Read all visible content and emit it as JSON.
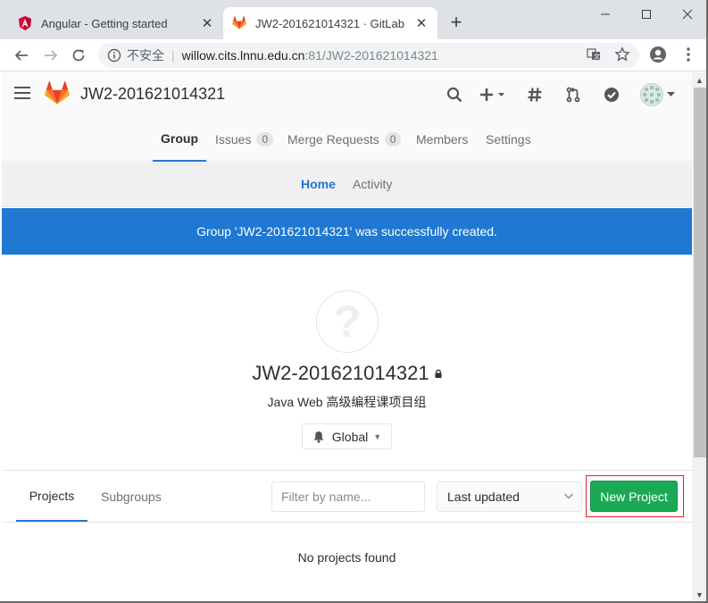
{
  "browser": {
    "tabs": [
      {
        "title": "Angular - Getting started",
        "active": false
      },
      {
        "title": "JW2-201621014321 · GitLab",
        "active": true
      }
    ],
    "address": {
      "security": "不安全",
      "host": "willow.cits.lnnu.edu.cn",
      "path": ":81/JW2-201621014321"
    }
  },
  "header": {
    "title": "JW2-201621014321"
  },
  "group_tabs": [
    {
      "label": "Group",
      "count": null
    },
    {
      "label": "Issues",
      "count": "0"
    },
    {
      "label": "Merge Requests",
      "count": "0"
    },
    {
      "label": "Members",
      "count": null
    },
    {
      "label": "Settings",
      "count": null
    }
  ],
  "sub_tabs": [
    "Home",
    "Activity"
  ],
  "flash": "Group 'JW2-201621014321' was successfully created.",
  "group": {
    "avatar_glyph": "?",
    "name": "JW2-201621014321",
    "description": "Java Web 高级编程课项目组",
    "notification": "Global"
  },
  "projects": {
    "tabs": [
      "Projects",
      "Subgroups"
    ],
    "filter_placeholder": "Filter by name...",
    "sort": "Last updated",
    "new_project": "New Project",
    "empty": "No projects found"
  },
  "colors": {
    "accent": "#1f78d1",
    "success": "#1aaa55",
    "highlight": "#e0202a"
  }
}
